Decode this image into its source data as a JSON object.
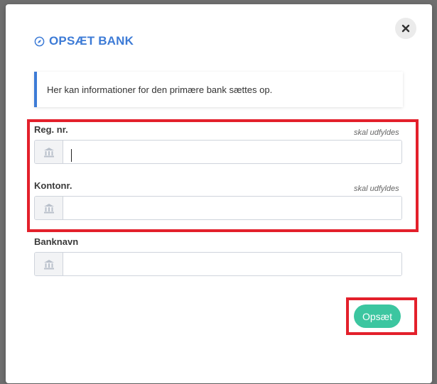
{
  "modal": {
    "title": "OPSÆT BANK",
    "title_icon": "compass-icon",
    "close_icon": "close-icon",
    "info_text": "Her kan informationer for den primære bank sættes op."
  },
  "fields": [
    {
      "label": "Reg. nr.",
      "required_hint": "skal udfyldes",
      "value": "",
      "icon": "bank-icon"
    },
    {
      "label": "Kontonr.",
      "required_hint": "skal udfyldes",
      "value": "",
      "icon": "bank-icon"
    },
    {
      "label": "Banknavn",
      "value": "",
      "icon": "bank-icon"
    }
  ],
  "actions": {
    "submit_label": "Opsæt"
  },
  "colors": {
    "accent": "#3d7bd6",
    "submit": "#3cc6a0",
    "highlight": "#e3202b"
  }
}
